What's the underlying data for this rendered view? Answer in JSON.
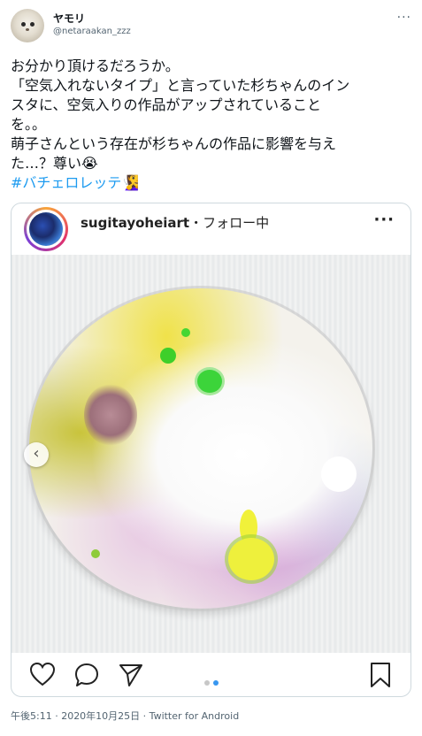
{
  "author": {
    "name": "ヤモリ",
    "handle": "@netaraakan_zzz",
    "more_label": "···"
  },
  "tweet": {
    "lines": [
      "お分かり頂けるだろうか。",
      "「空気入れないタイプ」と言っていた杉ちゃんのイン",
      "スタに、空気入りの作品がアップされていること",
      "を。。",
      "萌子さんという存在が杉ちゃんの作品に影響を与え",
      "た…？尊い😭"
    ],
    "hashtag": "#バチェロレッテ🧏‍♀️"
  },
  "instagram_embed": {
    "username": "sugitayoheiart",
    "follow_label": "・フォロー中",
    "more_label": "···",
    "prev_label": "‹",
    "carousel_dots": 2,
    "active_dot": 2
  },
  "footer": {
    "timestamp": "午後5:11 · 2020年10月25日 · Twitter for Android"
  },
  "colors": {
    "link": "#1d9bf0",
    "secondary_text": "#536471",
    "border": "#cfd9de",
    "ig_dot_active": "#3897f0"
  }
}
